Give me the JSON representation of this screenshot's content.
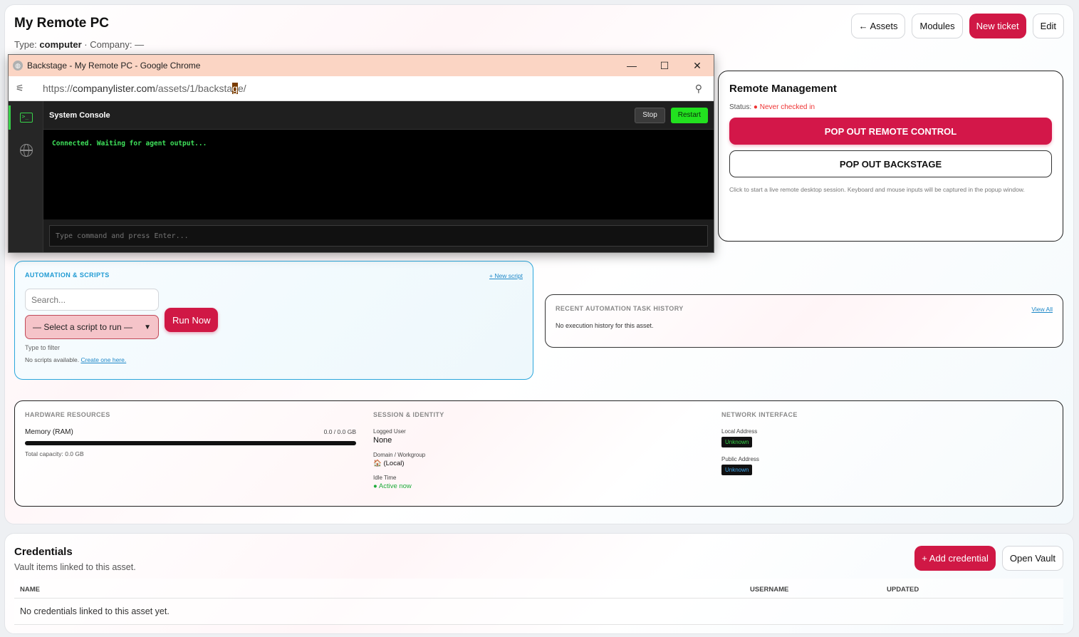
{
  "page": {
    "title": "My Remote PC",
    "type_label": "Type:",
    "type_value": "computer",
    "company_label": "· Company: —"
  },
  "top_actions": {
    "assets": "← Assets",
    "modules": "Modules",
    "new_ticket": "New ticket",
    "edit": "Edit"
  },
  "chrome": {
    "window_title": "Backstage - My Remote PC - Google Chrome",
    "minimize": "—",
    "maximize": "☐",
    "close": "✕",
    "url_prefix": "https://",
    "url_host": "companylister.com",
    "url_path_1": "/assets/1/backsta",
    "url_highlight": "g",
    "url_path_2": "e/"
  },
  "console": {
    "title": "System Console",
    "stop": "Stop",
    "restart": "Restart",
    "output": "Connected. Waiting for agent output...",
    "input_placeholder": "Type command and press Enter..."
  },
  "remote": {
    "title": "Remote Management",
    "status_label": "Status:",
    "status_value": "● Never checked in",
    "btn_remote_control": "POP OUT REMOTE CONTROL",
    "btn_backstage": "POP OUT BACKSTAGE",
    "hint": "Click to start a live remote desktop session. Keyboard and mouse inputs will be captured in the popup window."
  },
  "automation": {
    "label": "AUTOMATION & SCRIPTS",
    "new_script": "+ New script",
    "search_placeholder": "Search...",
    "select_value": "— Select a script to run —",
    "run_now": "Run Now",
    "hint_filter": "Type to filter",
    "no_scripts": "No scripts available.",
    "create_link": "Create one here."
  },
  "history": {
    "label": "RECENT AUTOMATION TASK HISTORY",
    "view_all": "View All",
    "empty": "No execution history for this asset."
  },
  "hardware": {
    "label": "HARDWARE RESOURCES",
    "memory_label": "Memory (RAM)",
    "memory_value": "0.0 / 0.0 GB",
    "memory_fraction": 0,
    "total": "Total capacity: 0.0 GB"
  },
  "session": {
    "label": "SESSION & IDENTITY",
    "logged_user_label": "Logged User",
    "logged_user": "None",
    "domain_label": "Domain / Workgroup",
    "domain": "🏠 (Local)",
    "idle_label": "Idle Time",
    "idle": "● Active now"
  },
  "network": {
    "label": "NETWORK INTERFACE",
    "local_label": "Local Address",
    "local_value": "Unknown",
    "public_label": "Public Address",
    "public_value": "Unknown"
  },
  "credentials": {
    "title": "Credentials",
    "subtitle": "Vault items linked to this asset.",
    "add": "+ Add credential",
    "open_vault": "Open Vault",
    "columns": [
      "NAME",
      "USERNAME",
      "UPDATED"
    ],
    "empty": "No credentials linked to this asset yet."
  }
}
